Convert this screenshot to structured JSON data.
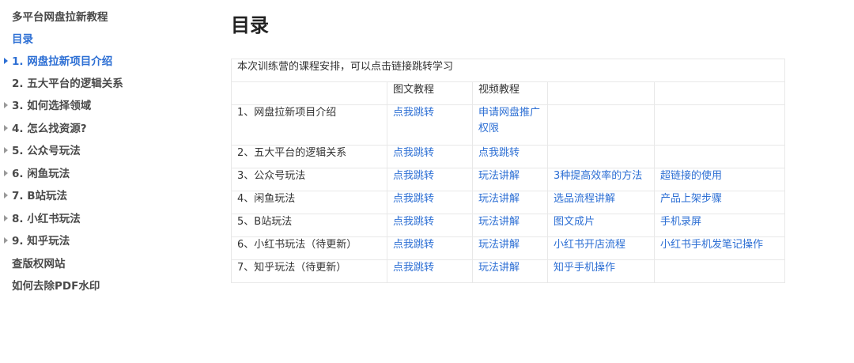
{
  "sidebar": {
    "items": [
      {
        "label": "多平台网盘拉新教程",
        "caret": false,
        "active": false
      },
      {
        "label": "目录",
        "caret": false,
        "active": true
      },
      {
        "label": "1. 网盘拉新项目介绍",
        "caret": true,
        "active": true
      },
      {
        "label": "2. 五大平台的逻辑关系",
        "caret": false,
        "active": false
      },
      {
        "label": "3. 如何选择领域",
        "caret": true,
        "active": false
      },
      {
        "label": "4. 怎么找资源?",
        "caret": true,
        "active": false
      },
      {
        "label": "5. 公众号玩法",
        "caret": true,
        "active": false
      },
      {
        "label": "6. 闲鱼玩法",
        "caret": true,
        "active": false
      },
      {
        "label": "7. B站玩法",
        "caret": true,
        "active": false
      },
      {
        "label": "8. 小红书玩法",
        "caret": true,
        "active": false
      },
      {
        "label": "9. 知乎玩法",
        "caret": true,
        "active": false
      },
      {
        "label": "查版权网站",
        "caret": false,
        "active": false
      },
      {
        "label": "如何去除PDF水印",
        "caret": false,
        "active": false
      }
    ]
  },
  "main": {
    "title": "目录",
    "table": {
      "caption": "本次训练营的课程安排，可以点击链接跳转学习",
      "headers": [
        "",
        "图文教程",
        "视频教程",
        "",
        ""
      ],
      "rows": [
        [
          "1、网盘拉新项目介绍",
          "点我跳转",
          "申请网盘推广权限",
          "",
          ""
        ],
        [
          "2、五大平台的逻辑关系",
          "点我跳转",
          "点我跳转",
          "",
          ""
        ],
        [
          "3、公众号玩法",
          "点我跳转",
          "玩法讲解",
          "3种提高效率的方法",
          "超链接的使用"
        ],
        [
          "4、闲鱼玩法",
          "点我跳转",
          "玩法讲解",
          "选品流程讲解",
          "产品上架步骤"
        ],
        [
          "5、B站玩法",
          "点我跳转",
          "玩法讲解",
          "图文成片",
          "手机录屏"
        ],
        [
          "6、小红书玩法（待更新）",
          "点我跳转",
          "玩法讲解",
          "小红书开店流程",
          "小红书手机发笔记操作"
        ],
        [
          "7、知乎玩法（待更新）",
          "点我跳转",
          "玩法讲解",
          "知乎手机操作",
          ""
        ]
      ]
    }
  },
  "colors": {
    "link": "#2d6fd4",
    "text": "#333333",
    "border": "#e8e8e8"
  }
}
